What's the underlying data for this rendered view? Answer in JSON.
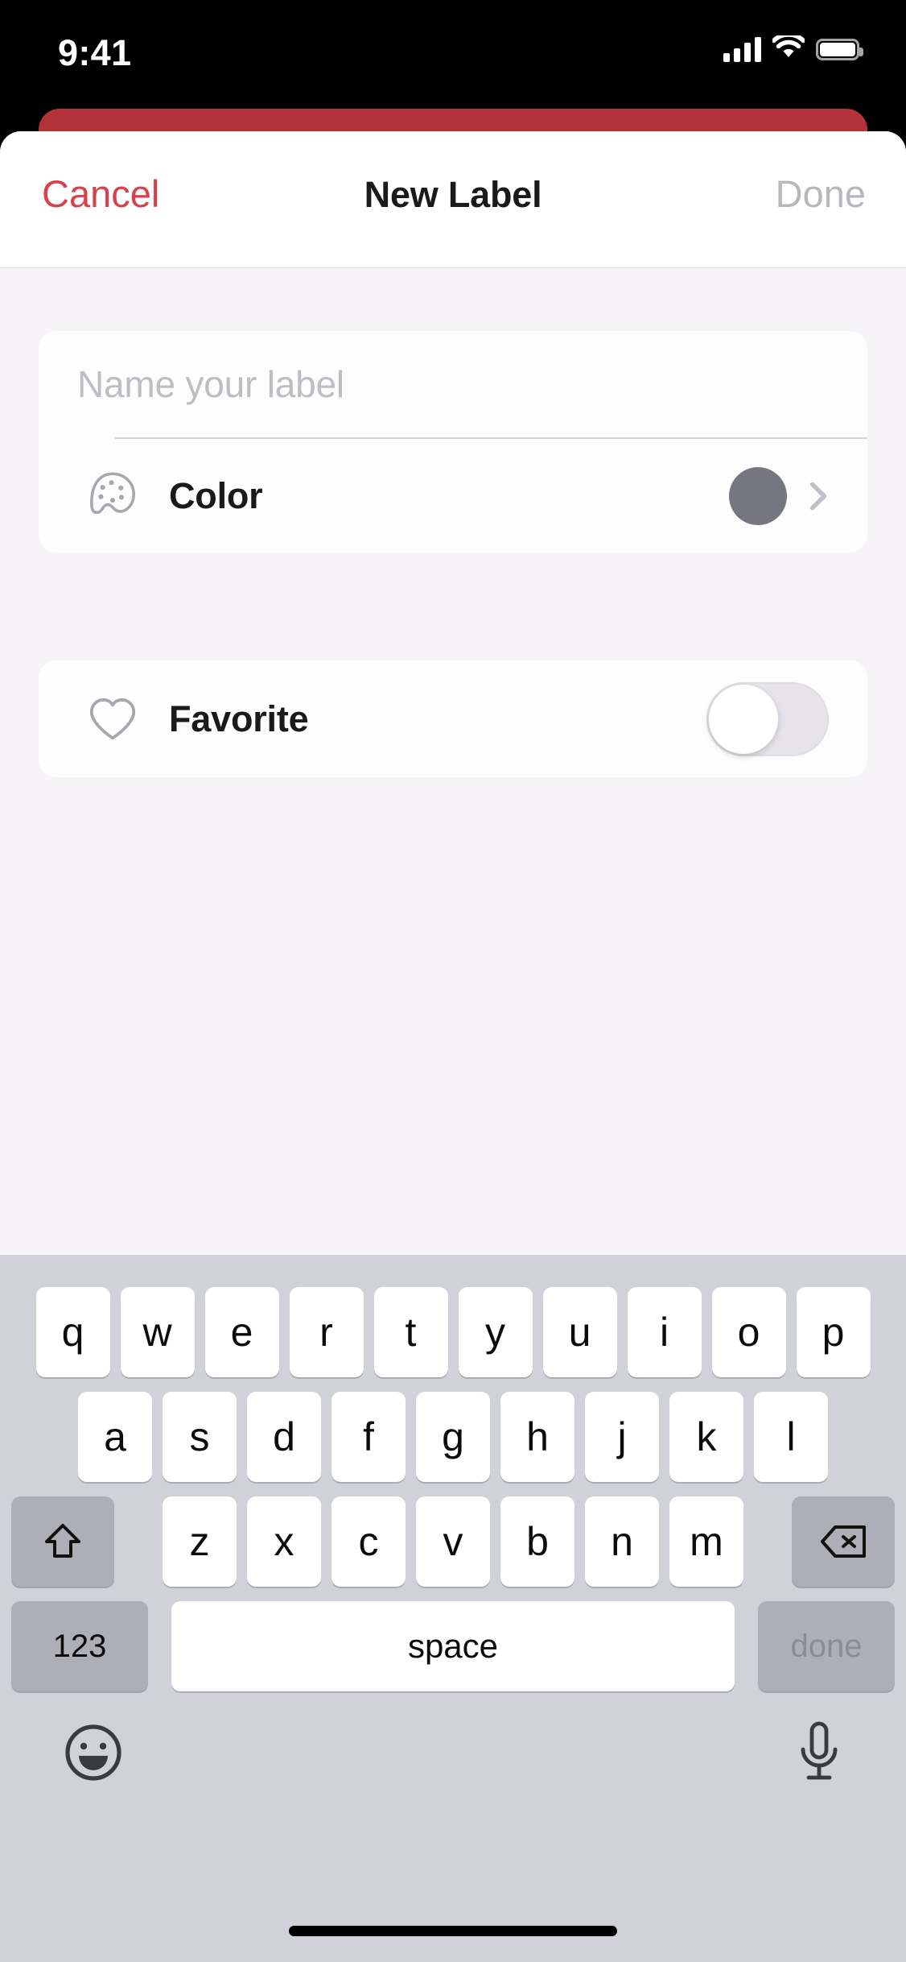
{
  "status_bar": {
    "time": "9:41",
    "signal_icon": "cellular-signal-icon",
    "wifi_icon": "wifi-icon",
    "battery_icon": "battery-full-icon"
  },
  "nav_bar": {
    "cancel_label": "Cancel",
    "title": "New Label",
    "done_label": "Done",
    "done_enabled": false,
    "cancel_color": "#D7414B",
    "done_color": "#B9B7BC"
  },
  "form": {
    "name_field": {
      "value": "",
      "placeholder": "Name your label"
    },
    "color_row": {
      "icon": "paint-palette-icon",
      "label": "Color",
      "swatch_color": "#767680",
      "chevron": "chevron-right-icon"
    },
    "favorite_row": {
      "icon": "heart-outline-icon",
      "label": "Favorite",
      "toggle_on": false
    }
  },
  "drag_indicator": {
    "color": "#8E8E93"
  },
  "keyboard": {
    "row1": [
      "q",
      "w",
      "e",
      "r",
      "t",
      "y",
      "u",
      "i",
      "o",
      "p"
    ],
    "row2": [
      "a",
      "s",
      "d",
      "f",
      "g",
      "h",
      "j",
      "k",
      "l"
    ],
    "row3_letters": [
      "z",
      "x",
      "c",
      "v",
      "b",
      "n",
      "m"
    ],
    "shift_icon": "shift-arrow-icon",
    "delete_icon": "delete-backward-icon",
    "numbers_label": "123",
    "space_label": "space",
    "done_label": "done",
    "emoji_icon": "emoji-smiley-icon",
    "mic_icon": "microphone-icon",
    "background_color": "#D1D2D9"
  },
  "sheet": {
    "background_color": "#F6F4F7",
    "behind_card_color": "#B4323A"
  }
}
